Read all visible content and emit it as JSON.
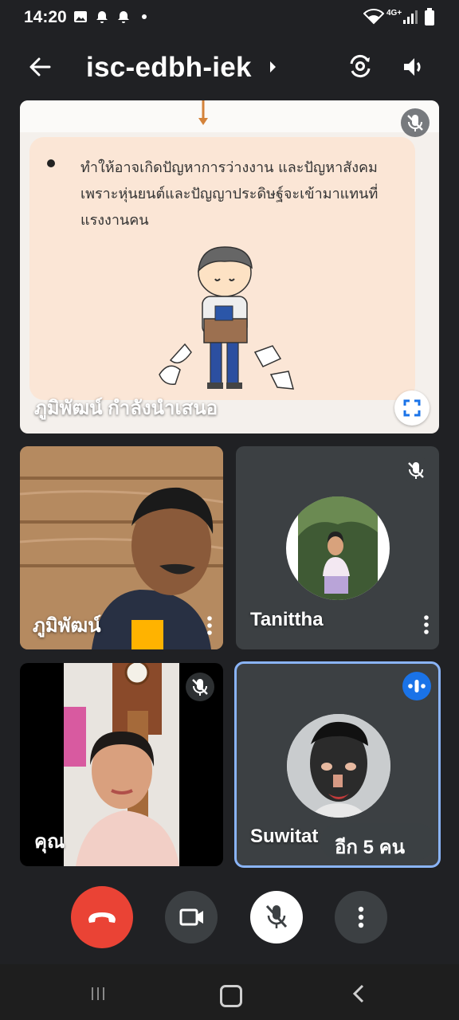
{
  "status_bar": {
    "time": "14:20",
    "network": "4G+"
  },
  "app_bar": {
    "meeting_code": "isc-edbh-iek"
  },
  "presentation": {
    "bullet_text": "ทำให้อาจเกิดปัญหาการว่างงาน และปัญหาสังคม เพราะหุ่นยนต์และปัญญาประดิษฐ์จะเข้ามาแทนที่แรงงานคน",
    "presenter_label": "ภูมิพัฒน์ กำลังนำเสนอ"
  },
  "participants": [
    {
      "name": "ภูมิพัฒน์"
    },
    {
      "name": "Tanittha"
    },
    {
      "name": "คุณ"
    },
    {
      "name": "Suwitat"
    }
  ],
  "more_participants": "อีก 5 คน",
  "colors": {
    "end_call": "#ea4335",
    "active_speaker": "#8ab4f8",
    "speaker_badge": "#1a73e8"
  }
}
